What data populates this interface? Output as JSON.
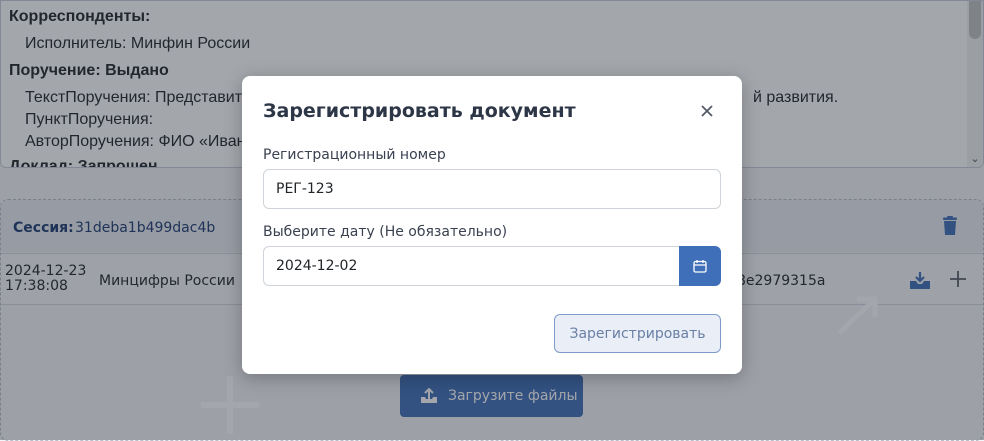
{
  "document": {
    "correspondents_heading": "Корреспонденты:",
    "executor_line": "Исполнитель: Минфин России",
    "assignment_heading": "Поручение: Выдано",
    "text_line_start": "ТекстПоручения: Представит",
    "text_line_end": "й развития.",
    "point_line": "ПунктПоручения:",
    "author_line": "АвторПоручения: ФИО «Иван",
    "report_heading": "Доклад: Запрошен"
  },
  "session": {
    "label": "Сессия:",
    "id": "31deba1b499dac4b",
    "file": {
      "date": "2024-12-23",
      "time": "17:38:08",
      "organization": "Минцифры России",
      "hash_fragment": "8e2979315a"
    },
    "upload_label": "Загрузите файлы"
  },
  "modal": {
    "title": "Зарегистрировать документ",
    "reg_number_label": "Регистрационный номер",
    "reg_number_value": "РЕГ-123",
    "date_label": "Выберите дату (Не обязательно)",
    "date_value": "2024-12-02",
    "submit_label": "Зарегистрировать"
  },
  "icons": {
    "close": "close-icon",
    "calendar": "calendar-icon",
    "trash": "trash-icon",
    "download": "download-icon",
    "add": "plus-icon",
    "upload": "upload-icon"
  },
  "colors": {
    "accent": "#3f6fb8",
    "title_text": "#2d3646",
    "overlay": "#242a38"
  }
}
